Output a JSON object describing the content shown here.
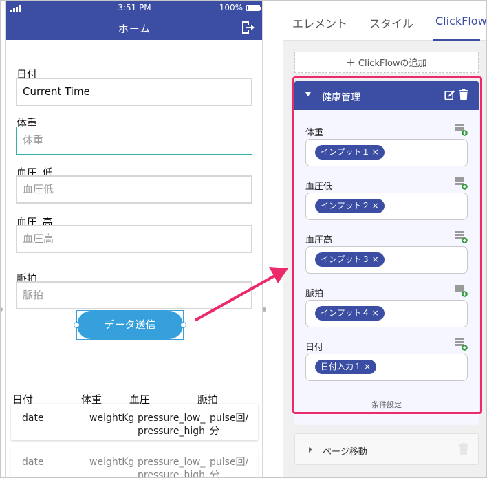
{
  "status_bar": {
    "time": "3:51 PM",
    "battery": "100%"
  },
  "nav": {
    "title": "ホーム"
  },
  "form": {
    "date_label": "日付",
    "date_value": "Current Time",
    "weight_label": "体重",
    "weight_placeholder": "体重",
    "bp_low_label": "血圧_低",
    "bp_low_placeholder": "血圧低",
    "bp_high_label": "血圧_高",
    "bp_high_placeholder": "血圧高",
    "pulse_label": "脈拍",
    "pulse_placeholder": "脈拍",
    "submit_label": "データ送信"
  },
  "table": {
    "headers": [
      "日付",
      "体重",
      "血圧",
      "脈拍"
    ],
    "rows": [
      {
        "date": "date",
        "weight": "weightKg",
        "pressure": "pressure_low_pressure_high",
        "pulse": "pulse回/分"
      },
      {
        "date": "date",
        "weight": "weightKg",
        "pressure": "pressure_low_pressure_high",
        "pulse": "pulse回/分"
      }
    ]
  },
  "panel": {
    "tabs": [
      "エレメント",
      "スタイル",
      "ClickFlow"
    ],
    "active_tab": "ClickFlow",
    "add_clickflow_label": "ClickFlowの追加",
    "clickflow": {
      "title": "健康管理",
      "fields": [
        {
          "label": "体重",
          "chip": "インプット１"
        },
        {
          "label": "血圧低",
          "chip": "インプット２"
        },
        {
          "label": "血圧高",
          "chip": "インプット３"
        },
        {
          "label": "脈拍",
          "chip": "インプット４"
        },
        {
          "label": "日付",
          "chip": "日付入力１"
        }
      ],
      "condition_label": "条件設定"
    },
    "page_move_label": "ページ移動"
  },
  "colors": {
    "primary": "#3b4ea3",
    "button": "#35a0dc",
    "highlight": "#ec2a6a",
    "focus": "#33b0a8",
    "db_icon_plus": "#2e9a3a"
  }
}
